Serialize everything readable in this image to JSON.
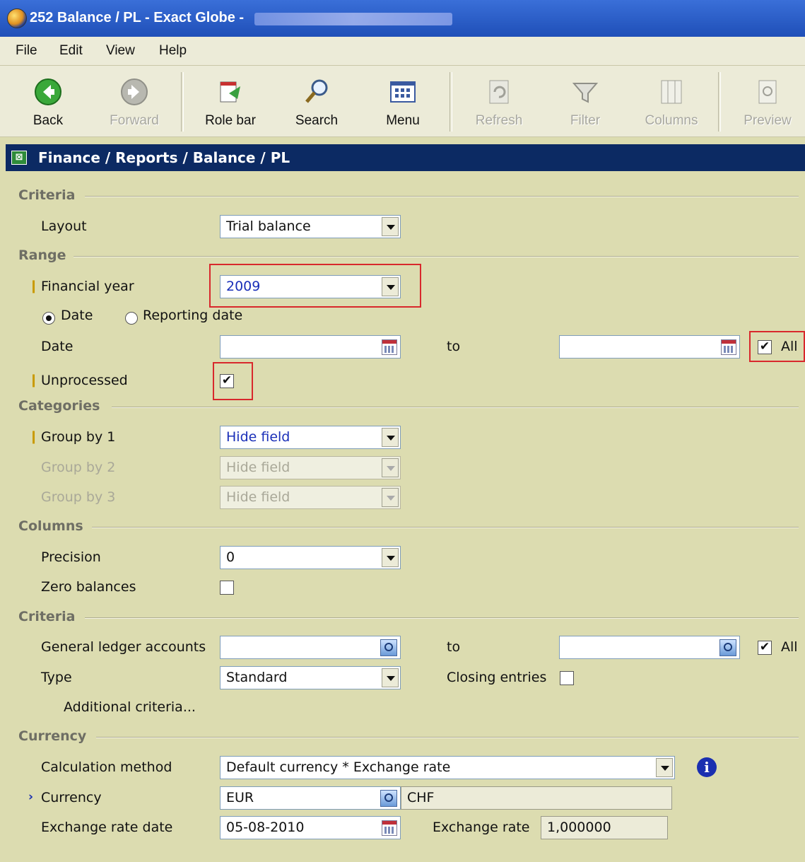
{
  "window": {
    "title": "252 Balance / PL - Exact Globe - "
  },
  "menu": [
    "File",
    "Edit",
    "View",
    "Help"
  ],
  "toolbar": {
    "back": "Back",
    "forward": "Forward",
    "role_bar": "Role bar",
    "search": "Search",
    "menu": "Menu",
    "refresh": "Refresh",
    "filter": "Filter",
    "columns": "Columns",
    "preview": "Preview"
  },
  "breadcrumb": "Finance / Reports / Balance / PL",
  "sections": {
    "criteria": "Criteria",
    "range": "Range",
    "categories": "Categories",
    "columns": "Columns",
    "criteria2": "Criteria",
    "currency": "Currency"
  },
  "form": {
    "layout_label": "Layout",
    "layout_value": "Trial balance",
    "financial_year_label": "Financial year",
    "financial_year_value": "2009",
    "radio_date": "Date",
    "radio_reporting_date": "Reporting date",
    "date_label": "Date",
    "date_from": "",
    "date_to_label": "to",
    "date_to": "",
    "date_all": "All",
    "unprocessed_label": "Unprocessed",
    "group1_label": "Group by 1",
    "group1_value": "Hide field",
    "group2_label": "Group by 2",
    "group2_value": "Hide field",
    "group3_label": "Group by 3",
    "group3_value": "Hide field",
    "precision_label": "Precision",
    "precision_value": "0",
    "zero_balances_label": "Zero balances",
    "gl_label": "General ledger accounts",
    "gl_from": "",
    "gl_to_label": "to",
    "gl_to": "",
    "gl_all": "All",
    "type_label": "Type",
    "type_value": "Standard",
    "closing_entries_label": "Closing entries",
    "additional_criteria": "Additional criteria...",
    "calc_method_label": "Calculation method",
    "calc_method_value": "Default currency * Exchange rate",
    "currency_label": "Currency",
    "currency_value": "EUR",
    "currency_secondary": "CHF",
    "exrate_date_label": "Exchange rate date",
    "exrate_date_value": "05-08-2010",
    "exrate_label": "Exchange rate",
    "exrate_value": "1,000000"
  },
  "checks": {
    "date_all": "✔",
    "unprocessed": "✔",
    "gl_all": "✔",
    "zero_balances": "",
    "closing_entries": ""
  },
  "colors": {
    "breadcrumb_bg": "#0c2a63",
    "highlight": "#d8282c",
    "form_bg": "#dcdcb0"
  }
}
